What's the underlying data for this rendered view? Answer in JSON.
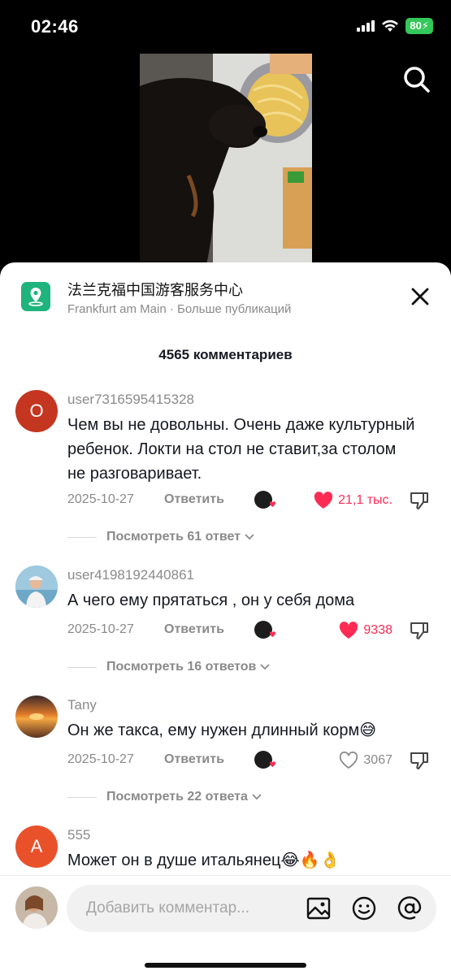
{
  "status": {
    "time": "02:46",
    "battery": "80"
  },
  "header": {
    "title": "法兰克福中国游客服务中心",
    "subtitle": "Frankfurt am Main · Больше публикаций"
  },
  "comments_count": "4565 комментариев",
  "comments": [
    {
      "avatar_letter": "O",
      "avatar_color": "#c4361f",
      "username": "user7316595415328",
      "text": "Чем вы не довольны. Очень даже культурный ребенок. Локти на стол не ставит,за столом не разговаривает.",
      "date": "2025-10-27",
      "reply_label": "Ответить",
      "likes": "21,1 тыс.",
      "liked": true,
      "view_replies": "Посмотреть 61 ответ"
    },
    {
      "avatar_letter": "",
      "avatar_color": "#9ec9de",
      "username": "user4198192440861",
      "text": "А чего ему прятаться , он у себя дома",
      "date": "2025-10-27",
      "reply_label": "Ответить",
      "likes": "9338",
      "liked": true,
      "view_replies": "Посмотреть 16 ответов"
    },
    {
      "avatar_letter": "",
      "avatar_color": "#d9772b",
      "username": "Tany",
      "text": "Он же такса, ему нужен длинный корм😅",
      "date": "2025-10-27",
      "reply_label": "Ответить",
      "likes": "3067",
      "liked": false,
      "view_replies": "Посмотреть 22 ответа"
    },
    {
      "avatar_letter": "A",
      "avatar_color": "#e9512b",
      "username": "555",
      "text": "Может он в душе итальянец😂🔥👌",
      "date": "",
      "reply_label": "",
      "likes": "",
      "liked": false,
      "view_replies": ""
    }
  ],
  "input": {
    "placeholder": "Добавить комментар..."
  },
  "colors": {
    "like_red": "#fe2c55",
    "accent_green": "#1fb37e"
  }
}
